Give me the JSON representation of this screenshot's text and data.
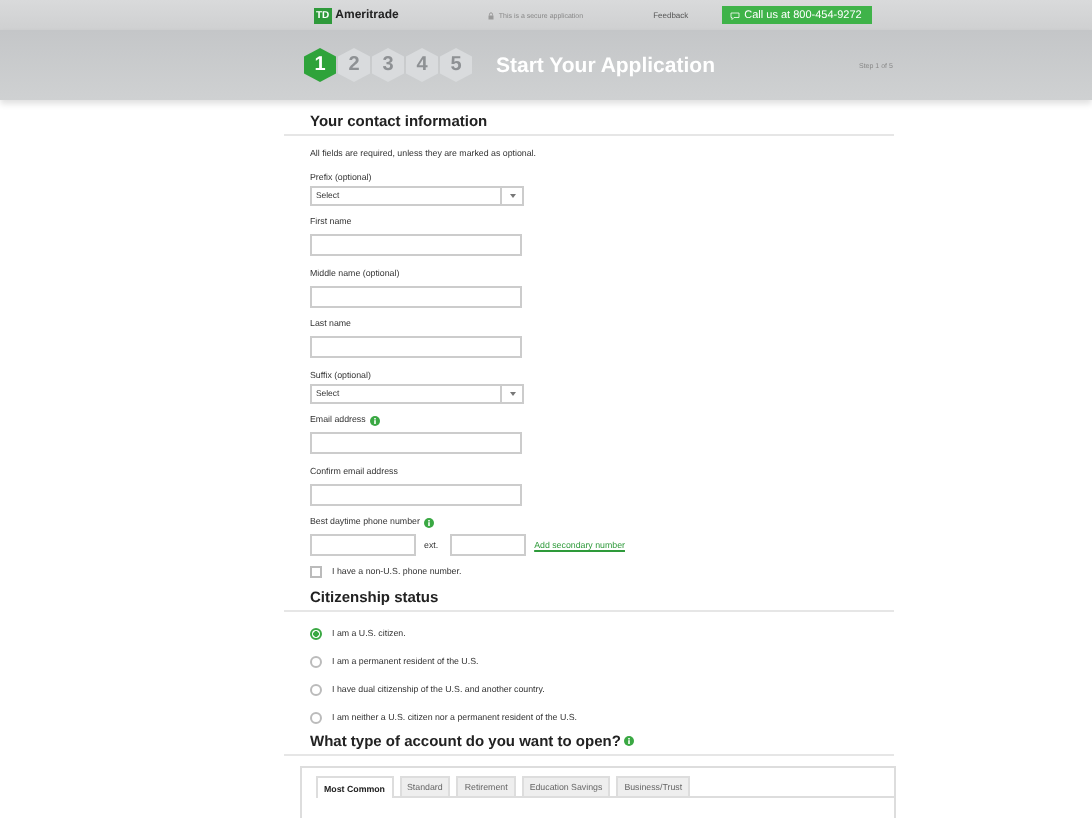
{
  "header": {
    "logo_badge": "TD",
    "logo_text": "Ameritrade",
    "secure_note": "This is a secure application",
    "feedback": "Feedback",
    "call_button": "Call us at 800-454-9272"
  },
  "steps": [
    {
      "label": "1",
      "selected": true
    },
    {
      "label": "2",
      "selected": false
    },
    {
      "label": "3",
      "selected": false
    },
    {
      "label": "4",
      "selected": false
    },
    {
      "label": "5",
      "selected": false
    }
  ],
  "page_title": "Start Your Application",
  "step_counter": "Step 1 of 5",
  "contact": {
    "heading": "Your contact information",
    "note": "All fields are required, unless they are marked as optional.",
    "fields": [
      {
        "kind": "select",
        "label": "Prefix (optional)",
        "value": "Select"
      },
      {
        "kind": "text",
        "label": "First name"
      },
      {
        "kind": "text",
        "label": "Middle name (optional)"
      },
      {
        "kind": "text",
        "label": "Last name"
      },
      {
        "kind": "select",
        "label": "Suffix (optional)",
        "value": "Select"
      },
      {
        "kind": "text",
        "label": "Email address",
        "info": true
      },
      {
        "kind": "text",
        "label": "Confirm email address"
      },
      {
        "kind": "phone",
        "label": "Best daytime phone number",
        "info": true,
        "ext_label": "ext.",
        "link": "Add secondary number"
      }
    ],
    "non_us_phone": {
      "label": "I have a non-U.S. phone number.",
      "checked": false
    }
  },
  "citizenship": {
    "heading": "Citizenship status",
    "options": [
      {
        "label": "I am a U.S. citizen.",
        "selected": true
      },
      {
        "label": "I am a permanent resident of the U.S.",
        "selected": false
      },
      {
        "label": "I have dual citizenship of the U.S. and another country.",
        "selected": false
      },
      {
        "label": "I am neither a U.S. citizen nor a permanent resident of the U.S.",
        "selected": false
      }
    ]
  },
  "account": {
    "heading": "What type of account do you want to open?",
    "info": true,
    "tabs": [
      {
        "label": "Most Common",
        "selected": true
      },
      {
        "label": "Standard",
        "selected": false
      },
      {
        "label": "Retirement",
        "selected": false
      },
      {
        "label": "Education Savings",
        "selected": false
      },
      {
        "label": "Business/Trust",
        "selected": false
      }
    ]
  }
}
